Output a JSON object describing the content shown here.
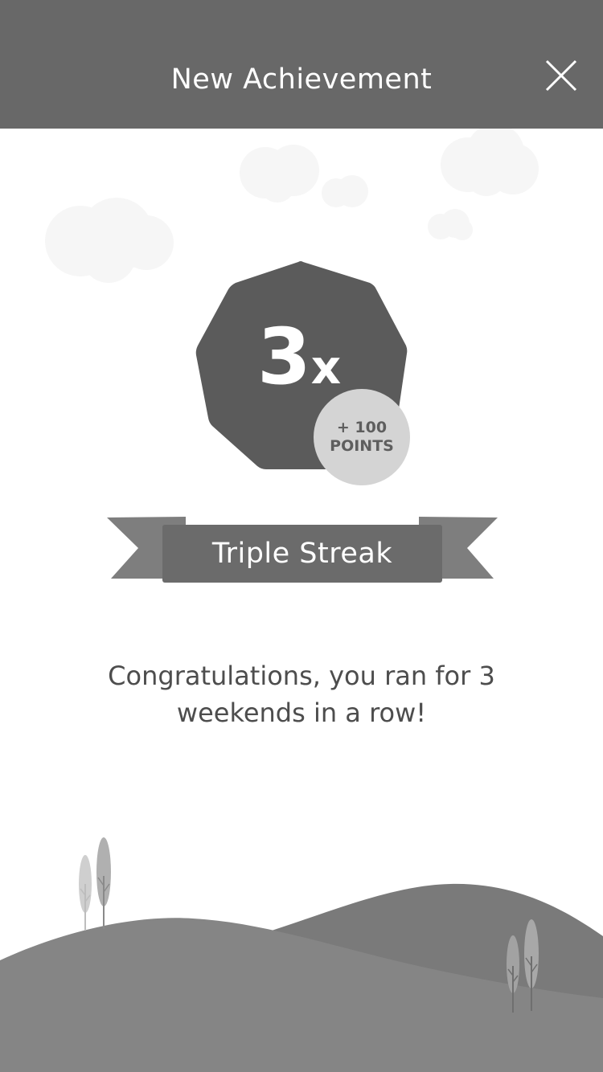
{
  "header": {
    "title": "New Achievement",
    "close_icon": "close-icon"
  },
  "badge": {
    "value": "3",
    "multiplier": "x",
    "points_amount": "+ 100",
    "points_unit": "POINTS"
  },
  "ribbon": {
    "label": "Triple Streak"
  },
  "message": "Congratulations, you ran for 3 weekends in a row!",
  "colors": {
    "header_bg": "#686868",
    "badge_fill": "#5b5b5b",
    "points_circle": "#d4d4d4",
    "ribbon_front": "#6b6b6b",
    "ribbon_tail": "#7e7e7e",
    "hill_back": "#7a7a7a",
    "hill_front": "#858585",
    "cloud": "#f7f7f7",
    "text_message": "#4d4d4d"
  },
  "icons": {
    "close": "close-icon",
    "clouds": "cloud-icon",
    "trees": "tree-icon"
  }
}
